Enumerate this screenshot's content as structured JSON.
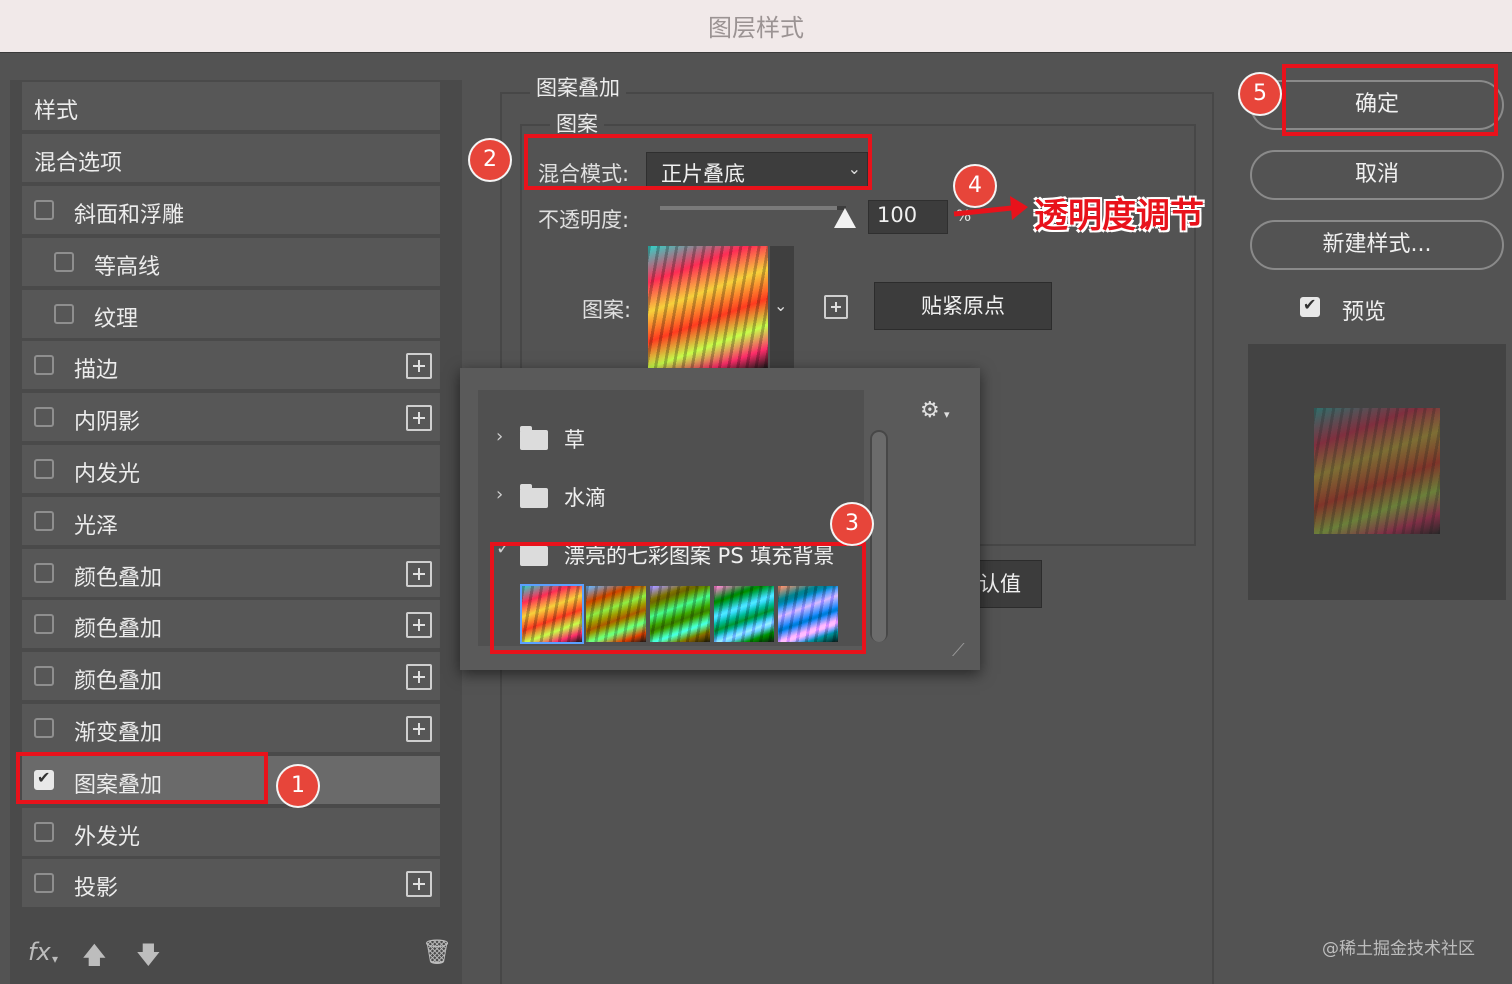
{
  "window": {
    "title": "图层样式"
  },
  "sidebar": {
    "header": "样式",
    "blend_options": "混合选项",
    "items": [
      {
        "label": "斜面和浮雕",
        "checked": false,
        "indent": false,
        "has_add": false
      },
      {
        "label": "等高线",
        "checked": false,
        "indent": true,
        "has_add": false
      },
      {
        "label": "纹理",
        "checked": false,
        "indent": true,
        "has_add": false
      },
      {
        "label": "描边",
        "checked": false,
        "indent": false,
        "has_add": true
      },
      {
        "label": "内阴影",
        "checked": false,
        "indent": false,
        "has_add": true
      },
      {
        "label": "内发光",
        "checked": false,
        "indent": false,
        "has_add": false
      },
      {
        "label": "光泽",
        "checked": false,
        "indent": false,
        "has_add": false
      },
      {
        "label": "颜色叠加",
        "checked": false,
        "indent": false,
        "has_add": true
      },
      {
        "label": "颜色叠加",
        "checked": false,
        "indent": false,
        "has_add": true
      },
      {
        "label": "颜色叠加",
        "checked": false,
        "indent": false,
        "has_add": true
      },
      {
        "label": "渐变叠加",
        "checked": false,
        "indent": false,
        "has_add": true
      },
      {
        "label": "图案叠加",
        "checked": true,
        "indent": false,
        "has_add": false,
        "selected": true
      },
      {
        "label": "外发光",
        "checked": false,
        "indent": false,
        "has_add": false
      },
      {
        "label": "投影",
        "checked": false,
        "indent": false,
        "has_add": true
      }
    ],
    "footer": {
      "fx_label": "fx",
      "icons": [
        "move-up-icon",
        "move-down-icon",
        "trash-icon"
      ]
    }
  },
  "pattern_overlay": {
    "section_title": "图案叠加",
    "group_title": "图案",
    "blend_mode_label": "混合模式:",
    "blend_mode_value": "正片叠底",
    "opacity_label": "不透明度:",
    "opacity_value": "100",
    "opacity_unit": "%",
    "opacity_fraction": 0.95,
    "pattern_label": "图案:",
    "snap_origin_button": "贴紧原点",
    "default_button_partial": "认值"
  },
  "pattern_picker": {
    "folders": [
      {
        "name": "草",
        "expanded": false
      },
      {
        "name": "水滴",
        "expanded": false
      },
      {
        "name": "漂亮的七彩图案 PS 填充背景",
        "expanded": true
      }
    ],
    "pattern_count": 5,
    "selected_pattern_index": 0
  },
  "right_panel": {
    "ok_button": "确定",
    "cancel_button": "取消",
    "new_style_button": "新建样式...",
    "preview_label": "预览",
    "preview_checked": true
  },
  "annotations": {
    "badges": [
      "1",
      "2",
      "3",
      "4",
      "5"
    ],
    "callout_text": "透明度调节",
    "highlight_color": "#e8121b",
    "badge_color": "#e7453a"
  },
  "watermark": "@稀土掘金技术社区"
}
